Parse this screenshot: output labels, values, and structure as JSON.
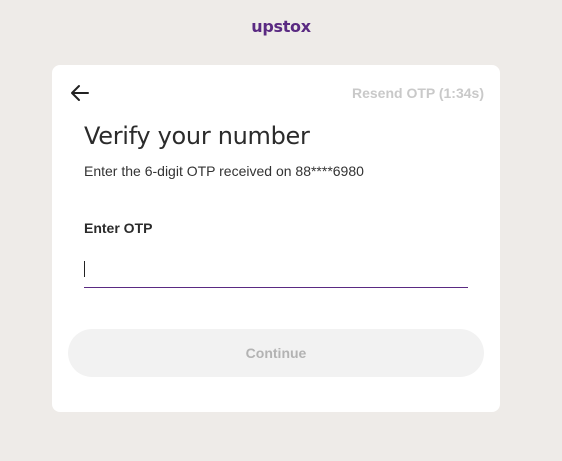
{
  "brand": {
    "logo_text": "upstox",
    "accent_color": "#5a2a82"
  },
  "card": {
    "back_icon": "arrow-left-icon",
    "resend_label": "Resend OTP (1:34s)",
    "title": "Verify your number",
    "subtitle": "Enter the 6-digit OTP received on 88****6980",
    "otp_label": "Enter OTP",
    "otp_value": "",
    "continue_label": "Continue"
  }
}
